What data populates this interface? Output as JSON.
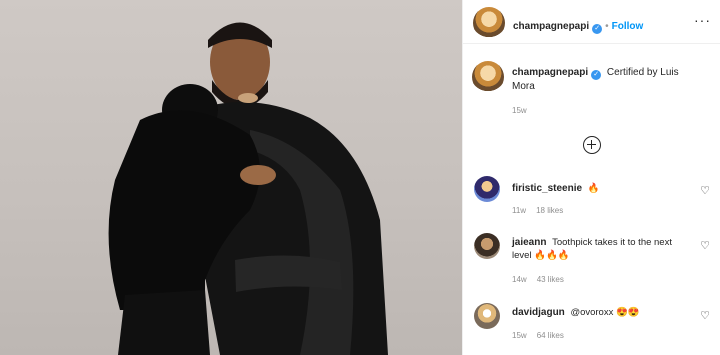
{
  "header": {
    "username": "champagnepapi",
    "separator": "•",
    "follow_label": "Follow",
    "more_label": "···"
  },
  "caption": {
    "username": "champagnepapi",
    "text": "Certified by Luis Mora",
    "age": "15w"
  },
  "comments": [
    {
      "username": "firistic_steenie",
      "text": "🔥",
      "age": "11w",
      "likes": "18 likes"
    },
    {
      "username": "jaieann",
      "text": "Toothpick takes it to the next level 🔥🔥🔥",
      "age": "14w",
      "likes": "43 likes"
    },
    {
      "username": "davidjagun",
      "text": "@ovoroxx 😍😍",
      "age": "15w",
      "likes": "64 likes"
    }
  ],
  "icons": {
    "verified": "verified-badge-icon",
    "more": "more-options-icon",
    "load_more": "plus-circle-icon",
    "like": "heart-icon"
  },
  "colors": {
    "follow": "#0095f6",
    "verified": "#3897f0",
    "muted": "#8e8e8e",
    "text": "#262626"
  }
}
